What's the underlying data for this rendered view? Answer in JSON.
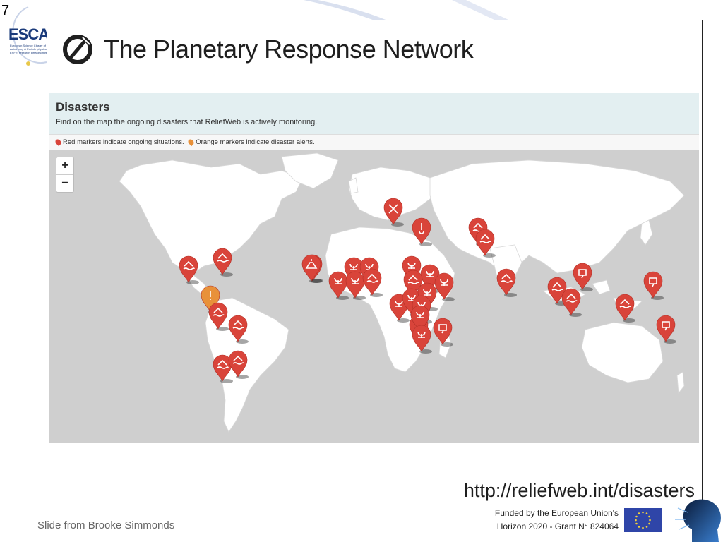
{
  "slide": {
    "number": "7",
    "logo_text": "ESCA",
    "logo_subtext": "European Science Cluster of Astronomy & Particle physics ESFRI research Infrastructures"
  },
  "header": {
    "title": "The Planetary Response Network"
  },
  "panel": {
    "title": "Disasters",
    "description": "Find on the map the ongoing disasters that ReliefWeb is actively monitoring.",
    "legend_red": "Red markers indicate ongoing situations.",
    "legend_orange": "Orange markers indicate disaster alerts.",
    "zoom_in": "+",
    "zoom_out": "−"
  },
  "colors": {
    "marker_red": "#d9443a",
    "marker_orange": "#e8913a",
    "land": "#ffffff",
    "water": "#cfcfcf"
  },
  "markers": [
    {
      "type": "red",
      "icon": "flood-icon"
    },
    {
      "type": "red",
      "icon": "flood-icon"
    },
    {
      "type": "orange",
      "icon": "alert-icon"
    },
    {
      "type": "red",
      "icon": "flood-icon"
    },
    {
      "type": "red",
      "icon": "flood-icon"
    },
    {
      "type": "red",
      "icon": "flood-icon"
    },
    {
      "type": "red",
      "icon": "flood-icon"
    },
    {
      "type": "red",
      "icon": "epidemic-icon"
    },
    {
      "type": "red",
      "icon": "epidemic-icon"
    },
    {
      "type": "red",
      "icon": "epidemic-icon"
    },
    {
      "type": "red",
      "icon": "epidemic-icon"
    },
    {
      "type": "red",
      "icon": "epidemic-icon"
    },
    {
      "type": "red",
      "icon": "flood-icon"
    },
    {
      "type": "red",
      "icon": "epidemic-icon"
    },
    {
      "type": "red",
      "icon": "epidemic-icon"
    },
    {
      "type": "red",
      "icon": "flood-icon"
    },
    {
      "type": "red",
      "icon": "epidemic-icon"
    },
    {
      "type": "red",
      "icon": "epidemic-icon"
    },
    {
      "type": "red",
      "icon": "epidemic-icon"
    },
    {
      "type": "red",
      "icon": "epidemic-icon"
    },
    {
      "type": "red",
      "icon": "epidemic-icon"
    },
    {
      "type": "red",
      "icon": "epidemic-icon"
    },
    {
      "type": "red",
      "icon": "storm-icon"
    },
    {
      "type": "red",
      "icon": "epidemic-icon"
    },
    {
      "type": "red",
      "icon": "conflict-icon"
    },
    {
      "type": "red",
      "icon": "thermometer-icon"
    },
    {
      "type": "red",
      "icon": "flood-icon"
    },
    {
      "type": "red",
      "icon": "flood-icon"
    },
    {
      "type": "red",
      "icon": "flood-icon"
    },
    {
      "type": "red",
      "icon": "flood-icon"
    },
    {
      "type": "red",
      "icon": "flood-icon"
    },
    {
      "type": "red",
      "icon": "storm-icon"
    },
    {
      "type": "red",
      "icon": "flood-icon"
    },
    {
      "type": "red",
      "icon": "storm-icon"
    },
    {
      "type": "red",
      "icon": "storm-icon"
    },
    {
      "type": "red",
      "icon": "epidemic-icon"
    },
    {
      "type": "red",
      "icon": "volcano-icon"
    }
  ],
  "url": "http://reliefweb.int/disasters",
  "footer": {
    "credit": "Slide from Brooke Simmonds",
    "funding_line1": "Funded by the European Union's",
    "funding_line2": "Horizon 2020 - Grant N° 824064"
  }
}
